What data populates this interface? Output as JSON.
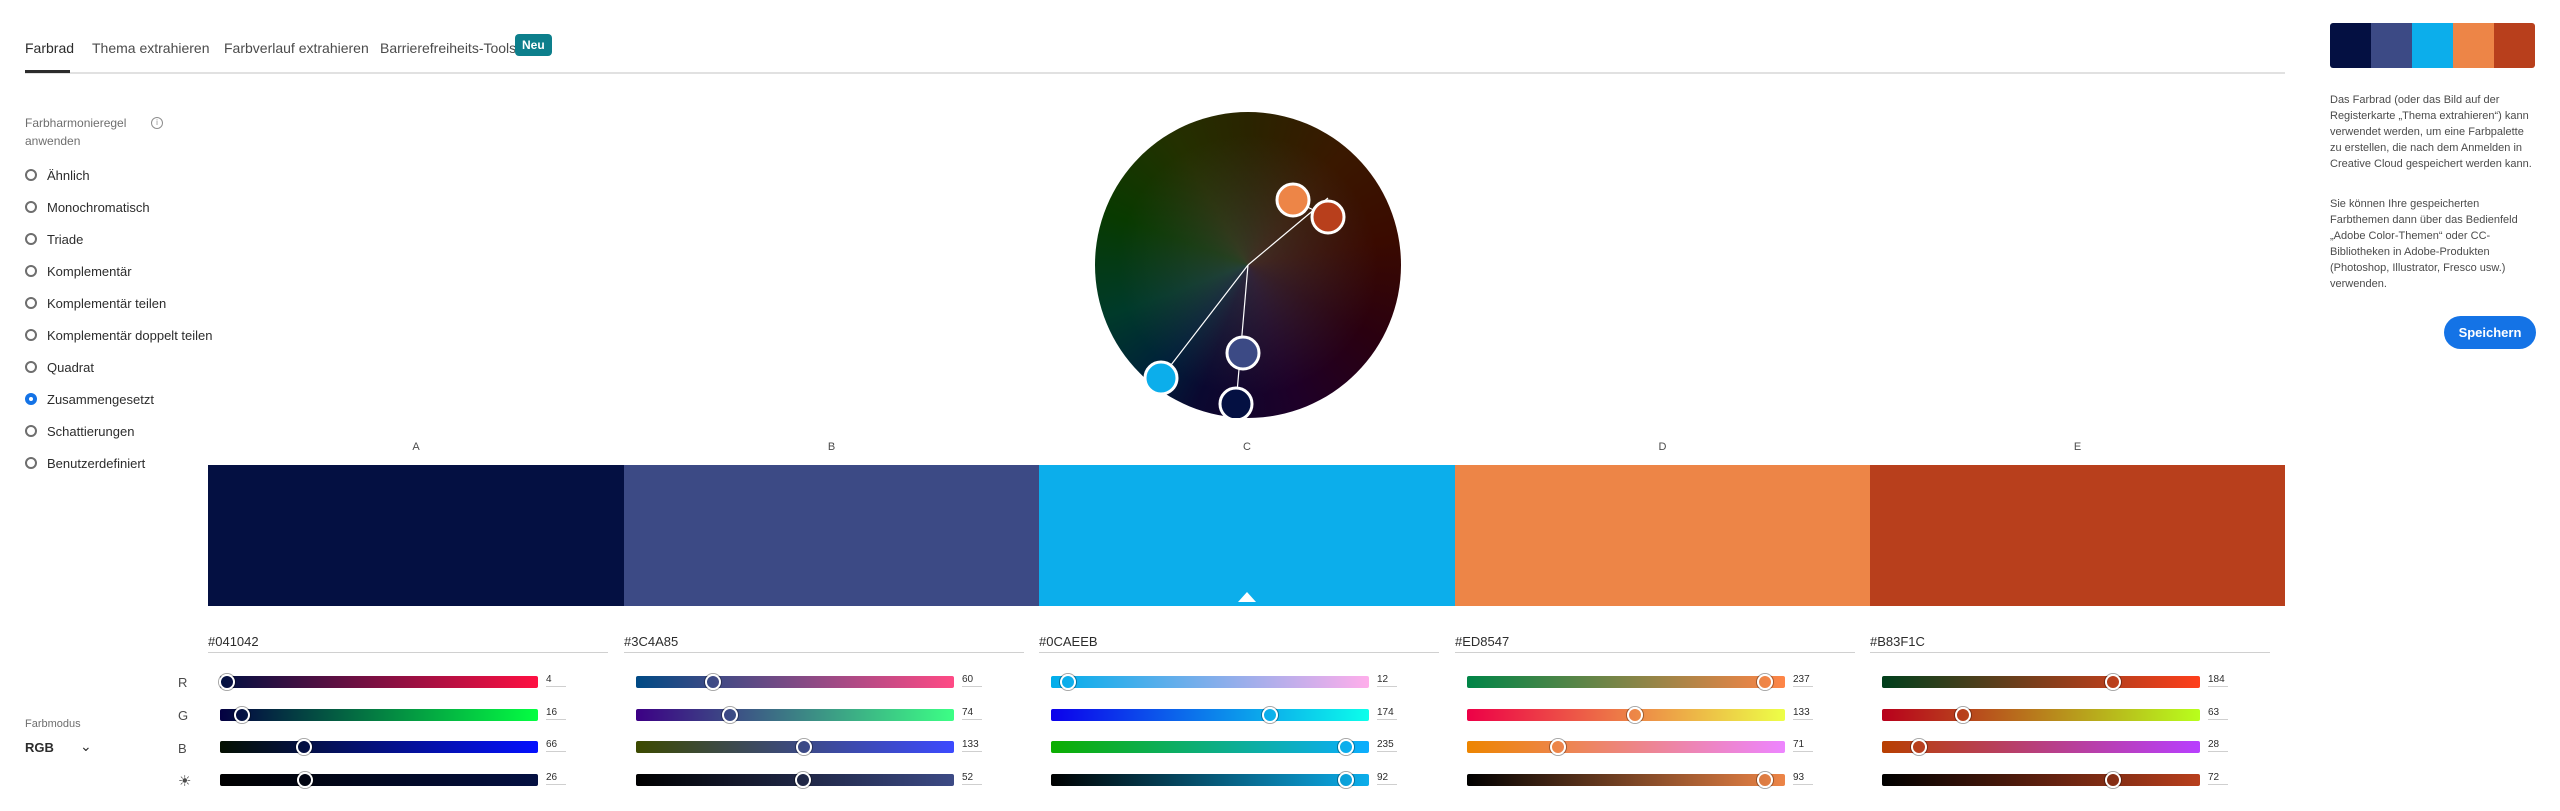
{
  "tabs": [
    {
      "label": "Farbrad",
      "active": true
    },
    {
      "label": "Thema extrahieren"
    },
    {
      "label": "Farbverlauf extrahieren"
    },
    {
      "label": "Barrierefreiheits-Tools"
    }
  ],
  "new_badge": "Neu",
  "harmony": {
    "title": "Farbharmonieregel anwenden",
    "info_icon": "info-icon",
    "options": [
      {
        "label": "Ähnlich",
        "checked": false
      },
      {
        "label": "Monochromatisch",
        "checked": false
      },
      {
        "label": "Triade",
        "checked": false
      },
      {
        "label": "Komplementär",
        "checked": false
      },
      {
        "label": "Komplementär teilen",
        "checked": false
      },
      {
        "label": "Komplementär doppelt teilen",
        "checked": false
      },
      {
        "label": "Quadrat",
        "checked": false
      },
      {
        "label": "Zusammengesetzt",
        "checked": true
      },
      {
        "label": "Schattierungen",
        "checked": false
      },
      {
        "label": "Benutzerdefiniert",
        "checked": false
      }
    ]
  },
  "mode": {
    "label": "Farbmodus",
    "value": "RGB",
    "chevron": "chevron-down-icon"
  },
  "row_labels": [
    "R",
    "G",
    "B"
  ],
  "brightness_icon": "brightness-icon",
  "colors": [
    {
      "letter": "A",
      "hex": "#041042",
      "r": "4",
      "g": "16",
      "b": "66",
      "brightness": "26",
      "rgb": [
        4,
        16,
        66
      ],
      "bright": 26
    },
    {
      "letter": "B",
      "hex": "#3C4A85",
      "r": "60",
      "g": "74",
      "b": "133",
      "brightness": "52",
      "rgb": [
        60,
        74,
        133
      ],
      "bright": 52
    },
    {
      "letter": "C",
      "hex": "#0CAEEB",
      "r": "12",
      "g": "174",
      "b": "235",
      "brightness": "92",
      "rgb": [
        12,
        174,
        235
      ],
      "bright": 92,
      "selected": true
    },
    {
      "letter": "D",
      "hex": "#ED8547",
      "r": "237",
      "g": "133",
      "b": "71",
      "brightness": "93",
      "rgb": [
        237,
        133,
        71
      ],
      "bright": 93
    },
    {
      "letter": "E",
      "hex": "#B83F1C",
      "r": "184",
      "g": "63",
      "b": "28",
      "brightness": "72",
      "rgb": [
        184,
        63,
        28
      ],
      "bright": 72
    }
  ],
  "sidebar": {
    "desc1": "Das Farbrad (oder das Bild auf der Registerkarte „Thema extrahieren“) kann verwendet werden, um eine Farbpalette zu erstellen, die nach dem Anmelden in Creative Cloud gespeichert werden kann.",
    "desc2": "Sie können Ihre gespeicherten Farbthemen dann über das Bedienfeld „Adobe Color-Themen“ oder CC-Bibliotheken in Adobe-Produkten (Photoshop, Illustrator, Fresco usw.) verwenden.",
    "save_label": "Speichern"
  }
}
